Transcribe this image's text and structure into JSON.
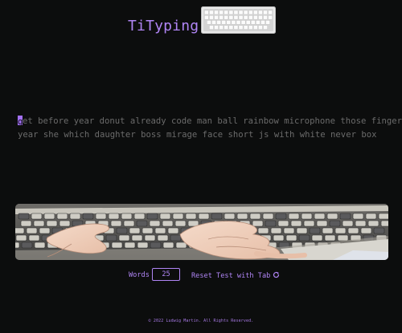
{
  "header": {
    "title": "TiTyping",
    "logo_icon": "keyboard-icon"
  },
  "typing_test": {
    "line_1_first_char": "g",
    "line_1_rest": "et before year donut already code man ball rainbow microphone those finger",
    "line_2": "year she which daughter boss mirage face short js with white never box"
  },
  "banner": {
    "icon": "anime-keyboard-hands-image"
  },
  "controls": {
    "words_label": "Words",
    "words_value": "25",
    "reset_label": "Reset Test with Tab",
    "reset_icon": "refresh-icon"
  },
  "footer": {
    "text": "© 2022 Ludwig Martin. All Rights Reserved."
  },
  "colors": {
    "accent": "#b085f5",
    "background": "#0c0d0d",
    "text_muted": "#6b6b6b"
  }
}
